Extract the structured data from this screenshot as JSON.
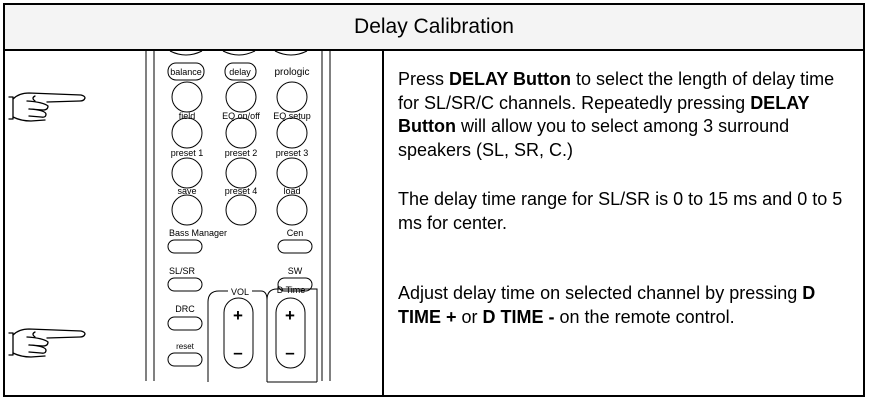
{
  "title": "Delay Calibration",
  "remote": {
    "labels": {
      "balance": "balance",
      "delay": "delay",
      "prologic": "prologic",
      "field": "field",
      "eq_onoff": "EQ on/off",
      "eq_setup": "EQ setup",
      "preset1": "preset 1",
      "preset2": "preset 2",
      "preset3": "preset 3",
      "save": "save",
      "preset4": "preset 4",
      "load": "load",
      "bass_manager": "Bass Manager",
      "cen": "Cen",
      "slsr": "SL/SR",
      "sw": "SW",
      "drc": "DRC",
      "reset": "reset",
      "vol": "VOL",
      "dtime": "D Time",
      "plus": "+",
      "minus": "–"
    }
  },
  "instructions": {
    "p1": {
      "t1": "Press ",
      "b1": "DELAY Button",
      "t2": " to select the length of delay time for SL/SR/C channels. Repeatedly pressing ",
      "b2": "DELAY Button",
      "t3": " will allow you to select among 3 surround speakers (SL, SR, C.)"
    },
    "p2": "The delay time range for SL/SR is 0 to 15 ms and 0 to 5 ms for center.",
    "p3": {
      "t1": "Adjust delay time on selected channel by pressing ",
      "b1": "D TIME +",
      "t2": " or ",
      "b2": "D TIME -",
      "t3": " on the remote control."
    }
  }
}
